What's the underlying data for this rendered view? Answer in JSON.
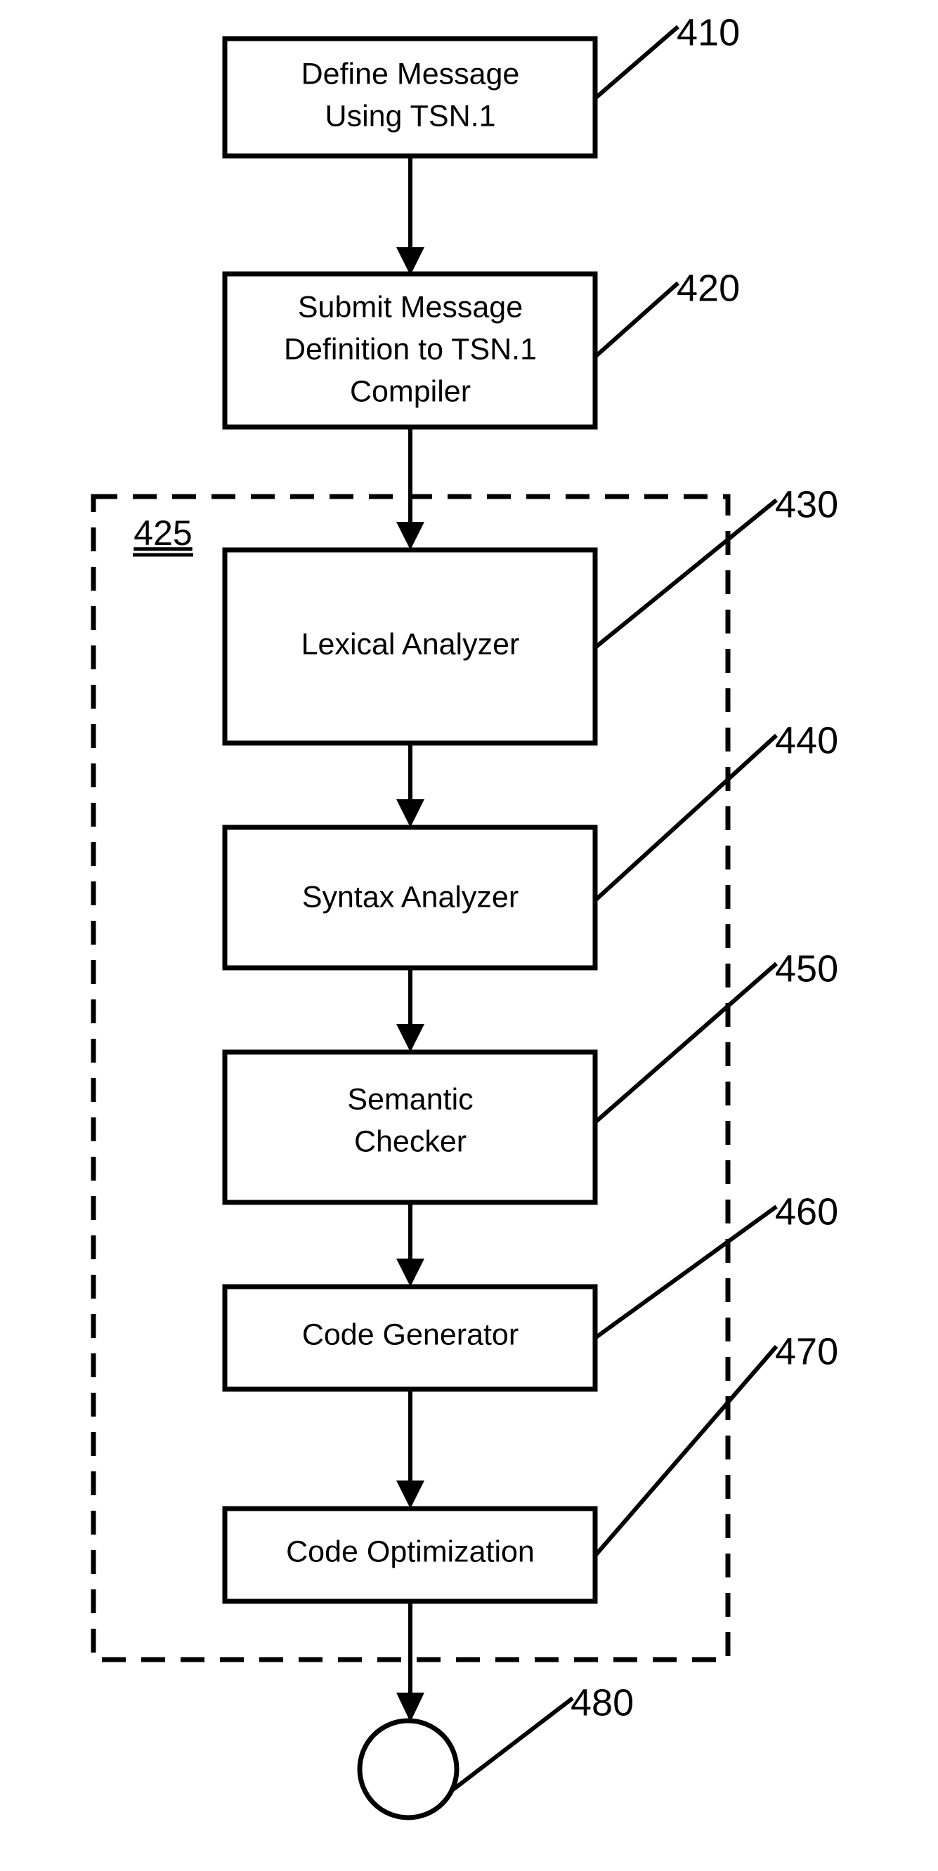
{
  "figure": {
    "type": "patent-flowchart",
    "title": "TSN.1 Compiler Process Flow",
    "background_color": "#ffffff",
    "line_color": "#000000"
  },
  "steps": [
    {
      "ref": "410",
      "lines": [
        "Define Message",
        "Using TSN.1"
      ],
      "shape": "rectangle"
    },
    {
      "ref": "420",
      "lines": [
        "Submit Message",
        "Definition to TSN.1",
        "Compiler"
      ],
      "shape": "rectangle"
    },
    {
      "ref": "430",
      "lines": [
        "Lexical Analyzer"
      ],
      "shape": "rectangle"
    },
    {
      "ref": "440",
      "lines": [
        "Syntax Analyzer"
      ],
      "shape": "rectangle"
    },
    {
      "ref": "450",
      "lines": [
        "Semantic",
        "Checker"
      ],
      "shape": "rectangle"
    },
    {
      "ref": "460",
      "lines": [
        "Code Generator"
      ],
      "shape": "rectangle"
    },
    {
      "ref": "470",
      "lines": [
        "Code Optimization"
      ],
      "shape": "rectangle"
    },
    {
      "ref": "480",
      "lines": [],
      "shape": "circle"
    }
  ],
  "group": {
    "ref": "425",
    "style": "dashed",
    "contains": [
      "430",
      "440",
      "450",
      "460",
      "470"
    ]
  },
  "labels": {
    "ref_410": "410",
    "ref_420": "420",
    "ref_425": "425",
    "ref_430": "430",
    "ref_440": "440",
    "ref_450": "450",
    "ref_460": "460",
    "ref_470": "470",
    "ref_480": "480"
  },
  "box_text": {
    "b410_l1": "Define Message",
    "b410_l2": "Using TSN.1",
    "b420_l1": "Submit Message",
    "b420_l2": "Definition to TSN.1",
    "b420_l3": "Compiler",
    "b430_l1": "Lexical Analyzer",
    "b440_l1": "Syntax Analyzer",
    "b450_l1": "Semantic",
    "b450_l2": "Checker",
    "b460_l1": "Code Generator",
    "b470_l1": "Code Optimization"
  }
}
